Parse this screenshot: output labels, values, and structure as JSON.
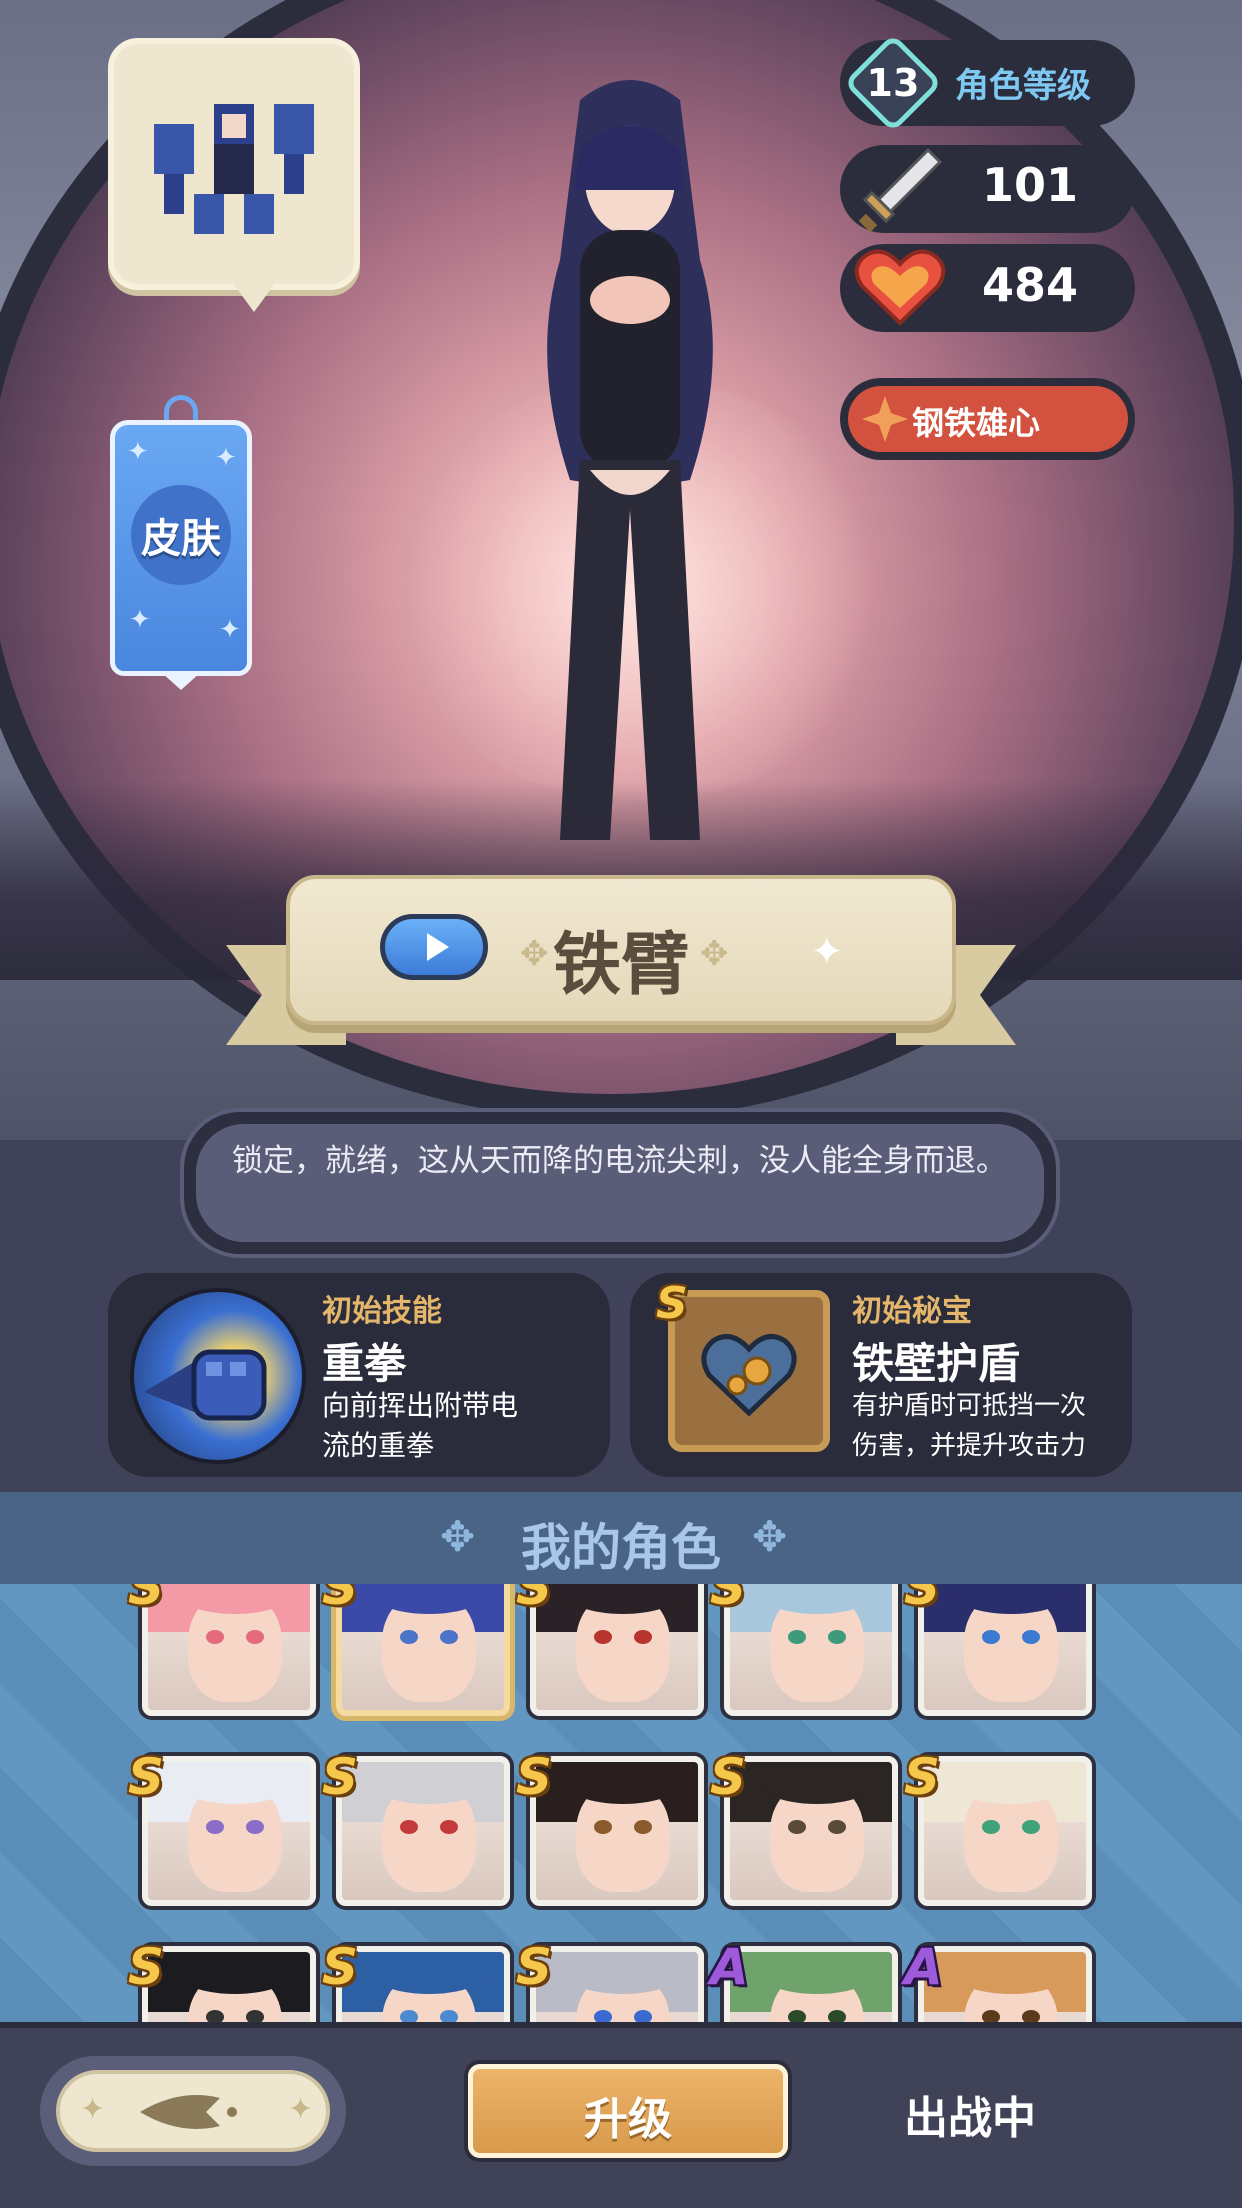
{
  "character": {
    "level": "13",
    "level_label": "角色等级",
    "attack": "101",
    "hp": "484",
    "trait": "钢铁雄心",
    "name": "铁臂",
    "description": "锁定，就绪，这从天而降的电流尖刺，没人能全身而退。"
  },
  "skin_button": {
    "label": "皮肤"
  },
  "skills": {
    "initial_skill": {
      "title": "初始技能",
      "name": "重拳",
      "desc_line1": "向前挥出附带电",
      "desc_line2": "流的重拳"
    },
    "initial_treasure": {
      "title": "初始秘宝",
      "rank": "S",
      "name": "铁壁护盾",
      "desc_line1": "有护盾时可抵挡一次",
      "desc_line2": "伤害，并提升攻击力"
    }
  },
  "roster": {
    "title": "我的角色",
    "rows": [
      [
        {
          "rank": "S",
          "hair": "#f39aa6",
          "eyes": "#e56a7c"
        },
        {
          "rank": "S",
          "hair": "#3b4aa8",
          "eyes": "#4b74c8",
          "selected": true
        },
        {
          "rank": "S",
          "hair": "#2a2226",
          "eyes": "#b8342e"
        },
        {
          "rank": "S",
          "hair": "#a9c7dc",
          "eyes": "#3d9a7a"
        },
        {
          "rank": "S",
          "hair": "#2a2e6a",
          "eyes": "#3a7ad0"
        }
      ],
      [
        {
          "rank": "S",
          "hair": "#e9ecf2",
          "eyes": "#8a6cc9"
        },
        {
          "rank": "S",
          "hair": "#cfcfd4",
          "eyes": "#c43a3a"
        },
        {
          "rank": "S",
          "hair": "#2a1f1f",
          "eyes": "#8a5a2a"
        },
        {
          "rank": "S",
          "hair": "#2b2523",
          "eyes": "#5a4a3a"
        },
        {
          "rank": "S",
          "hair": "#efe7d6",
          "eyes": "#3fa37a"
        }
      ],
      [
        {
          "rank": "S",
          "hair": "#1b1b20",
          "eyes": "#333"
        },
        {
          "rank": "S",
          "hair": "#2d5fa5",
          "eyes": "#4b8ad0"
        },
        {
          "rank": "S",
          "hair": "#b9bcc6",
          "eyes": "#3a6ad0"
        },
        {
          "rank": "A",
          "hair": "#6fa36b",
          "eyes": "#2a4a2a"
        },
        {
          "rank": "A",
          "hair": "#d79a5a",
          "eyes": "#5a3a1a"
        }
      ]
    ]
  },
  "bottom_bar": {
    "upgrade_label": "升级",
    "deploy_status": "出战中"
  },
  "colors": {
    "accent_gold": "#e3b66b",
    "trait_red": "#d2513f",
    "roster_blue": "#4a6486",
    "upgrade_orange": "#d99a4b"
  }
}
